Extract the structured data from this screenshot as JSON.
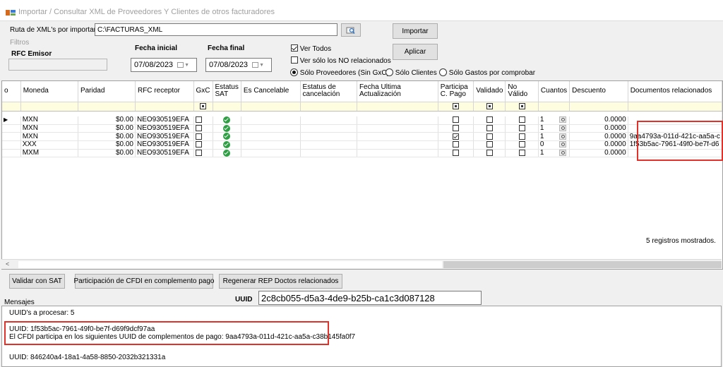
{
  "window": {
    "title": "Importar / Consultar XML de Proveedores Y Clientes de otros facturadores"
  },
  "form": {
    "ruta_label": "Ruta de XML's por importar",
    "ruta_value": "C:\\FACTURAS_XML",
    "importar_label": "Importar",
    "aplicar_label": "Aplicar",
    "filtros_label": "Filtros",
    "rfc_emisor_label": "RFC Emisor",
    "rfc_emisor_value": "",
    "fecha_inicial_label": "Fecha inicial",
    "fecha_inicial_value": "07/08/2023",
    "fecha_final_label": "Fecha final",
    "fecha_final_value": "07/08/2023",
    "ver_todos_label": "Ver Todos",
    "ver_todos_checked": true,
    "ver_no_relacionados_label": "Ver sólo los NO relacionados",
    "radio_options": [
      "Sólo Proveedores (Sin GxC)",
      "Sólo Clientes",
      "Sólo Gastos por comprobar"
    ],
    "radio_selected": 0
  },
  "grid": {
    "columns": [
      {
        "key": "idx",
        "label": "o"
      },
      {
        "key": "moneda",
        "label": "Moneda"
      },
      {
        "key": "paridad",
        "label": "Paridad"
      },
      {
        "key": "rfc_receptor",
        "label": "RFC receptor"
      },
      {
        "key": "gxc",
        "label": "GxC"
      },
      {
        "key": "estatus_sat",
        "label": "Estatus SAT"
      },
      {
        "key": "es_cancelable",
        "label": "Es Cancelable"
      },
      {
        "key": "estatus_cancelacion",
        "label": "Estatus de cancelación"
      },
      {
        "key": "fecha_ult",
        "label": "Fecha Ultima Actualización"
      },
      {
        "key": "participa",
        "label": "Participa C. Pago"
      },
      {
        "key": "validado",
        "label": "Validado"
      },
      {
        "key": "no_valido",
        "label": "No Válido"
      },
      {
        "key": "cuantos",
        "label": "Cuantos"
      },
      {
        "key": "descuento",
        "label": "Descuento"
      },
      {
        "key": "docs",
        "label": "Documentos relacionados"
      }
    ],
    "rows": [
      {
        "moneda": "MXN",
        "paridad": "$0.00",
        "rfc": "NEO930519EFA",
        "participa": false,
        "cuantos": "1",
        "descuento": "0.0000",
        "docs": ""
      },
      {
        "moneda": "MXN",
        "paridad": "$0.00",
        "rfc": "NEO930519EFA",
        "participa": false,
        "cuantos": "1",
        "descuento": "0.0000",
        "docs": ""
      },
      {
        "moneda": "MXN",
        "paridad": "$0.00",
        "rfc": "NEO930519EFA",
        "participa": true,
        "cuantos": "1",
        "descuento": "0.0000",
        "docs": "9aa4793a-011d-421c-aa5a-c"
      },
      {
        "moneda": "XXX",
        "paridad": "$0.00",
        "rfc": "NEO930519EFA",
        "participa": false,
        "cuantos": "0",
        "descuento": "0.0000",
        "docs": "1f53b5ac-7961-49f0-be7f-d6"
      },
      {
        "moneda": "MXM",
        "paridad": "$0.00",
        "rfc": "NEO930519EFA",
        "participa": false,
        "cuantos": "1",
        "descuento": "0.0000",
        "docs": ""
      }
    ],
    "status": "5 registros mostrados."
  },
  "actions": {
    "validar_label": "Validar con SAT",
    "participacion_label": "Participación de CFDI en complemento pago",
    "regenerar_label": "Regenerar  REP Doctos relacionados",
    "uuid_label": "UUID",
    "uuid_value": "2c8cb055-d5a3-4de9-b25b-ca1c3d087128"
  },
  "messages": {
    "label": "Mensajes",
    "lines": [
      "UUID's a procesar: 5",
      "UUID: 1f53b5ac-7961-49f0-be7f-d69f9dcf97aa",
      "El CFDI participa en los siguientes UUID de complementos de pago: 9aa4793a-011d-421c-aa5a-c38b145fa0f7",
      "UUID: 846240a4-18a1-4a58-8850-2032b321331a"
    ]
  },
  "colors": {
    "highlight": "#e0312b",
    "filter_row": "#fffde0",
    "sat_ok": "#2ea043"
  }
}
